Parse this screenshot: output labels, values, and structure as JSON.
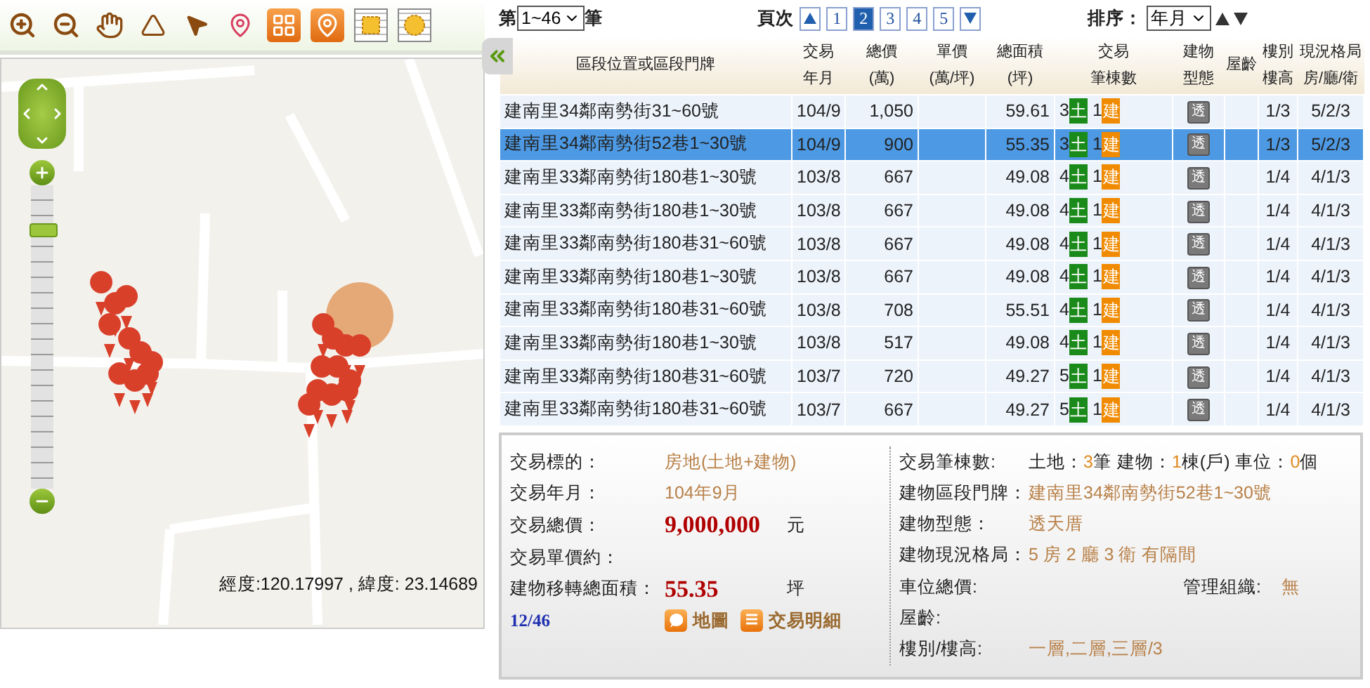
{
  "map": {
    "zoom": {
      "level": 0.85
    },
    "coordinates": "經度:120.17997 , 緯度: 23.14689"
  },
  "pager": {
    "count_prefix": "第",
    "count_select": "1~46",
    "count_suffix": "筆",
    "page_label": "頁次",
    "pages": [
      {
        "label": "1",
        "selected": false
      },
      {
        "label": "2",
        "selected": true
      },
      {
        "label": "3",
        "selected": false
      },
      {
        "label": "4",
        "selected": false
      },
      {
        "label": "5",
        "selected": false
      }
    ],
    "sort_label": "排序：",
    "sort_select": "年月"
  },
  "table": {
    "columns": [
      {
        "lines": [
          "區段位置或區段門牌"
        ]
      },
      {
        "lines": [
          "交易",
          "年月"
        ]
      },
      {
        "lines": [
          "總價",
          "(萬)"
        ]
      },
      {
        "lines": [
          "單價",
          "(萬/坪)"
        ]
      },
      {
        "lines": [
          "總面積",
          "(坪)"
        ]
      },
      {
        "lines": [
          "交易",
          "筆棟數"
        ]
      },
      {
        "lines": [
          "建物",
          "型態"
        ]
      },
      {
        "lines": [
          "屋齡"
        ]
      },
      {
        "lines": [
          "樓別",
          "樓高"
        ]
      },
      {
        "lines": [
          "現況格局",
          "房/廳/衛"
        ]
      }
    ],
    "rows": [
      {
        "address": "建南里34鄰南勢街31~60號",
        "date": "104/9",
        "total": "1,050",
        "area": "59.61",
        "land_count": "3",
        "land_tag": "土",
        "building_count": "1",
        "building_tag": "建",
        "type_tag": "透",
        "floor": "1/3",
        "layout": "5/2/3",
        "selected": false
      },
      {
        "address": "建南里34鄰南勢街52巷1~30號",
        "date": "104/9",
        "total": "900",
        "area": "55.35",
        "land_count": "3",
        "land_tag": "土",
        "building_count": "1",
        "building_tag": "建",
        "type_tag": "透",
        "floor": "1/3",
        "layout": "5/2/3",
        "selected": true
      },
      {
        "address": "建南里33鄰南勢街180巷1~30號",
        "date": "103/8",
        "total": "667",
        "area": "49.08",
        "land_count": "4",
        "land_tag": "土",
        "building_count": "1",
        "building_tag": "建",
        "type_tag": "透",
        "floor": "1/4",
        "layout": "4/1/3",
        "selected": false
      },
      {
        "address": "建南里33鄰南勢街180巷1~30號",
        "date": "103/8",
        "total": "667",
        "area": "49.08",
        "land_count": "4",
        "land_tag": "土",
        "building_count": "1",
        "building_tag": "建",
        "type_tag": "透",
        "floor": "1/4",
        "layout": "4/1/3",
        "selected": false
      },
      {
        "address": "建南里33鄰南勢街180巷31~60號",
        "date": "103/8",
        "total": "667",
        "area": "49.08",
        "land_count": "4",
        "land_tag": "土",
        "building_count": "1",
        "building_tag": "建",
        "type_tag": "透",
        "floor": "1/4",
        "layout": "4/1/3",
        "selected": false
      },
      {
        "address": "建南里33鄰南勢街180巷1~30號",
        "date": "103/8",
        "total": "667",
        "area": "49.08",
        "land_count": "4",
        "land_tag": "土",
        "building_count": "1",
        "building_tag": "建",
        "type_tag": "透",
        "floor": "1/4",
        "layout": "4/1/3",
        "selected": false
      },
      {
        "address": "建南里33鄰南勢街180巷31~60號",
        "date": "103/8",
        "total": "708",
        "area": "55.51",
        "land_count": "4",
        "land_tag": "土",
        "building_count": "1",
        "building_tag": "建",
        "type_tag": "透",
        "floor": "1/4",
        "layout": "4/1/3",
        "selected": false
      },
      {
        "address": "建南里33鄰南勢街180巷1~30號",
        "date": "103/8",
        "total": "517",
        "area": "49.08",
        "land_count": "4",
        "land_tag": "土",
        "building_count": "1",
        "building_tag": "建",
        "type_tag": "透",
        "floor": "1/4",
        "layout": "4/1/3",
        "selected": false
      },
      {
        "address": "建南里33鄰南勢街180巷31~60號",
        "date": "103/7",
        "total": "720",
        "area": "49.27",
        "land_count": "5",
        "land_tag": "土",
        "building_count": "1",
        "building_tag": "建",
        "type_tag": "透",
        "floor": "1/4",
        "layout": "4/1/3",
        "selected": false
      },
      {
        "address": "建南里33鄰南勢街180巷31~60號",
        "date": "103/7",
        "total": "667",
        "area": "49.27",
        "land_count": "5",
        "land_tag": "土",
        "building_count": "1",
        "building_tag": "建",
        "type_tag": "透",
        "floor": "1/4",
        "layout": "4/1/3",
        "selected": false
      }
    ]
  },
  "detail": {
    "left": [
      {
        "kind": "plain",
        "label": "交易標的：",
        "value": "房地(土地+建物)"
      },
      {
        "kind": "plain",
        "label": "交易年月：",
        "value": "104年9月"
      },
      {
        "kind": "emphasis",
        "label": "交易總價：",
        "value": "9,000,000",
        "unit": "元"
      },
      {
        "label": "交易單價約："
      },
      {
        "kind": "emphasis",
        "label": "建物移轉總面積：",
        "value": "55.35",
        "unit": "坪"
      }
    ],
    "counter": "12/46",
    "links": [
      "地圖",
      "交易明細"
    ],
    "counts_label": "交易筆棟數:",
    "counts": [
      {
        "label": "土地：",
        "count": "3",
        "unit": "筆"
      },
      {
        "label": "建物：",
        "count": "1",
        "unit": "棟(戶)"
      },
      {
        "label": "車位：",
        "count": "0",
        "unit": "個"
      }
    ],
    "right": [
      {
        "label": "建物區段門牌：",
        "value": "建南里34鄰南勢街52巷1~30號"
      },
      {
        "label": "建物型態：",
        "value": "透天厝"
      },
      {
        "label": "建物現況格局：",
        "value": "5 房 2 廳 3 衛 有隔間"
      },
      {
        "label": "車位總價:",
        "extra_label": "管理組織:",
        "extra_value": "無"
      },
      {
        "label": "屋齡:"
      },
      {
        "label": "樓別/樓高:",
        "value": "一層,二層,三層/3"
      }
    ]
  }
}
